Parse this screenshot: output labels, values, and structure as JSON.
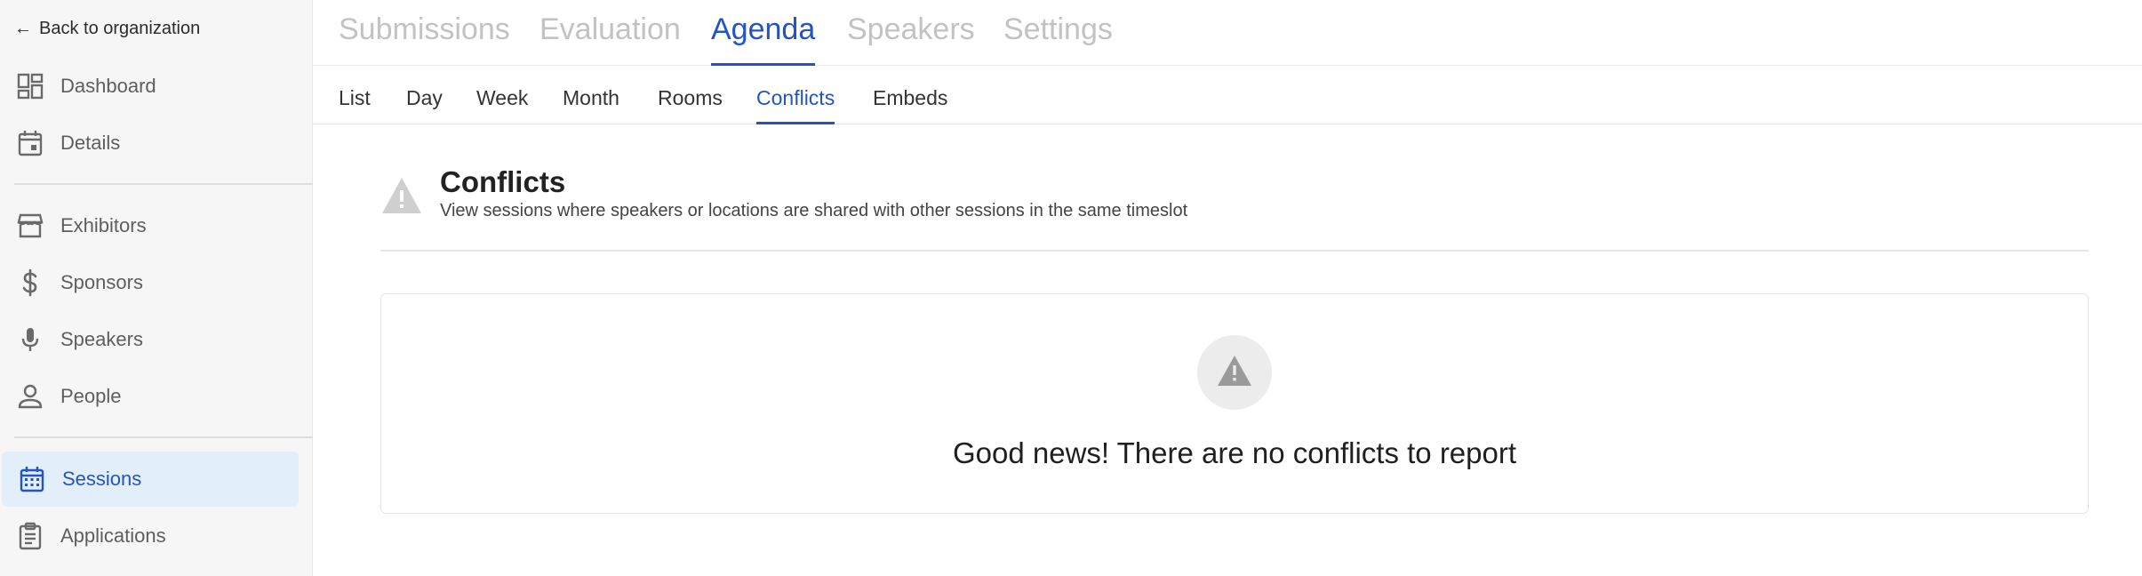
{
  "sidebar": {
    "back_label": "Back to organization",
    "items": [
      {
        "label": "Dashboard",
        "icon": "dashboard-icon"
      },
      {
        "label": "Details",
        "icon": "calendar-icon"
      },
      {
        "label": "Exhibitors",
        "icon": "storefront-icon"
      },
      {
        "label": "Sponsors",
        "icon": "dollar-icon"
      },
      {
        "label": "Speakers",
        "icon": "microphone-icon"
      },
      {
        "label": "People",
        "icon": "person-icon"
      },
      {
        "label": "Sessions",
        "icon": "calendar-grid-icon",
        "active": true
      },
      {
        "label": "Applications",
        "icon": "clipboard-icon"
      }
    ]
  },
  "top_tabs": {
    "items": [
      "Submissions",
      "Evaluation",
      "Agenda",
      "Speakers",
      "Settings"
    ],
    "active": "Agenda"
  },
  "sub_tabs": {
    "items": [
      "List",
      "Day",
      "Week",
      "Month",
      "Rooms",
      "Conflicts",
      "Embeds"
    ],
    "active": "Conflicts"
  },
  "header": {
    "title": "Conflicts",
    "subtitle": "View sessions where speakers or locations are shared with other sessions in the same timeslot",
    "icon": "warning-icon"
  },
  "empty_state": {
    "message": "Good news! There are no conflicts to report",
    "icon": "warning-icon"
  },
  "colors": {
    "accent": "#2453c4",
    "active_bg": "#e3eefb",
    "sidebar_bg": "#f6f6f6",
    "muted_tab": "#c2c2c2"
  }
}
